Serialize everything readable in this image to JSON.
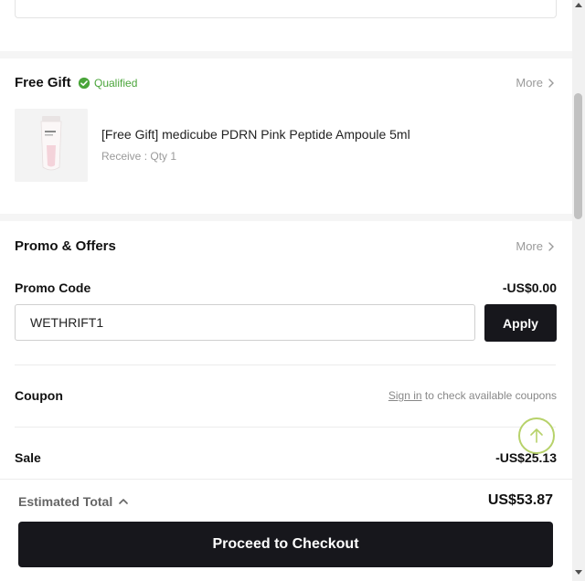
{
  "free_gift": {
    "title": "Free Gift",
    "badge": "Qualified",
    "more": "More",
    "item_name": "[Free Gift] medicube PDRN Pink Peptide Ampoule 5ml",
    "item_qty": "Receive : Qty 1"
  },
  "promo": {
    "title": "Promo & Offers",
    "more": "More",
    "code_label": "Promo Code",
    "code_discount": "-US$0.00",
    "code_value": "WETHRIFT1",
    "apply_label": "Apply",
    "coupon_label": "Coupon",
    "coupon_signin": "Sign in",
    "coupon_hint": " to check available coupons",
    "sale_label": "Sale",
    "sale_value": "-US$25.13"
  },
  "footer": {
    "estimated_label": "Estimated Total",
    "estimated_value": "US$53.87",
    "checkout_label": "Proceed to Checkout"
  },
  "icons": {
    "qualified": "check-badge-icon",
    "more": "chevron-right-icon",
    "scroll_top": "arrow-up-icon",
    "estimated_toggle": "chevron-up-icon"
  },
  "colors": {
    "accent_green": "#4aa53a",
    "button_dark": "#17171c",
    "fab_border": "#b7d26a"
  }
}
